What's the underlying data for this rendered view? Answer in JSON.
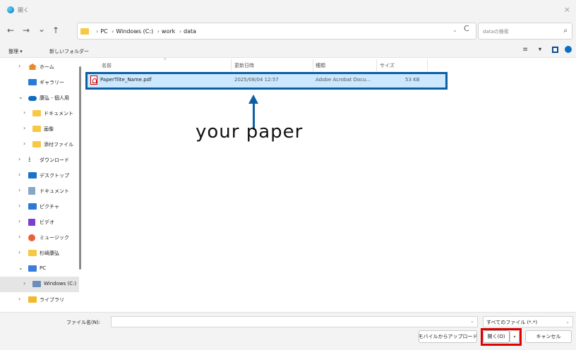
{
  "window": {
    "title": "開く",
    "close_glyph": "×"
  },
  "nav": {
    "back": "←",
    "forward": "→",
    "recent": "⌄",
    "up": "↑",
    "breadcrumb": [
      "PC",
      "Windows (C:)",
      "work",
      "data"
    ],
    "dropdown": "⌄",
    "refresh": "C",
    "search_placeholder": "dataの検索",
    "search_icon": "⌕"
  },
  "commandbar": {
    "organize": "整理 ▾",
    "new_folder": "新しいフォルダー",
    "view_icons": "≡ ▾"
  },
  "sidebar": {
    "items": [
      {
        "chevron": "›",
        "label": "ホーム",
        "icon": "home-icon"
      },
      {
        "chevron": "",
        "label": "ギャラリー",
        "icon": "gallery-icon"
      },
      {
        "chevron": "⌄",
        "label": "康弘 - 個人用",
        "icon": "onedrive-icon"
      },
      {
        "chevron": "›",
        "label": "ドキュメント",
        "icon": "folder-icon"
      },
      {
        "chevron": "›",
        "label": "画像",
        "icon": "folder-icon"
      },
      {
        "chevron": "›",
        "label": "添付ファイル",
        "icon": "folder-icon"
      },
      {
        "chevron": "›",
        "label": "ダウンロード",
        "icon": "download-icon"
      },
      {
        "chevron": "›",
        "label": "デスクトップ",
        "icon": "desktop-icon"
      },
      {
        "chevron": "›",
        "label": "ドキュメント",
        "icon": "documents-icon"
      },
      {
        "chevron": "›",
        "label": "ピクチャ",
        "icon": "pictures-icon"
      },
      {
        "chevron": "›",
        "label": "ビデオ",
        "icon": "videos-icon"
      },
      {
        "chevron": "›",
        "label": "ミュージック",
        "icon": "music-icon"
      },
      {
        "chevron": "›",
        "label": "杉崎康弘",
        "icon": "folder-icon"
      },
      {
        "chevron": "⌄",
        "label": "PC",
        "icon": "pc-icon"
      },
      {
        "chevron": "›",
        "label": "Windows (C:)",
        "icon": "drive-icon"
      },
      {
        "chevron": "›",
        "label": "ライブラリ",
        "icon": "library-icon"
      }
    ]
  },
  "table": {
    "headers": [
      "名前",
      "更新日時",
      "種類",
      "サイズ"
    ],
    "sort_indicator": "^",
    "rows": [
      {
        "name": "PaperTilte_Name.pdf",
        "modified": "2025/08/04 12:57",
        "type": "Adobe Acrobat Docu...",
        "size": "53 KB"
      }
    ]
  },
  "annotation": {
    "text": "your paper",
    "highlight_color": "#0b5fa5",
    "open_highlight_color": "#e00000"
  },
  "footer": {
    "filename_label": "ファイル名(N):",
    "filename_value": "",
    "filter": "すべてのファイル (*.*)",
    "dropdown": "⌄",
    "upload_button": "モバイルからアップロード",
    "open_button": "開く(O)",
    "open_dropdown": "▾",
    "cancel_button": "キャンセル"
  }
}
